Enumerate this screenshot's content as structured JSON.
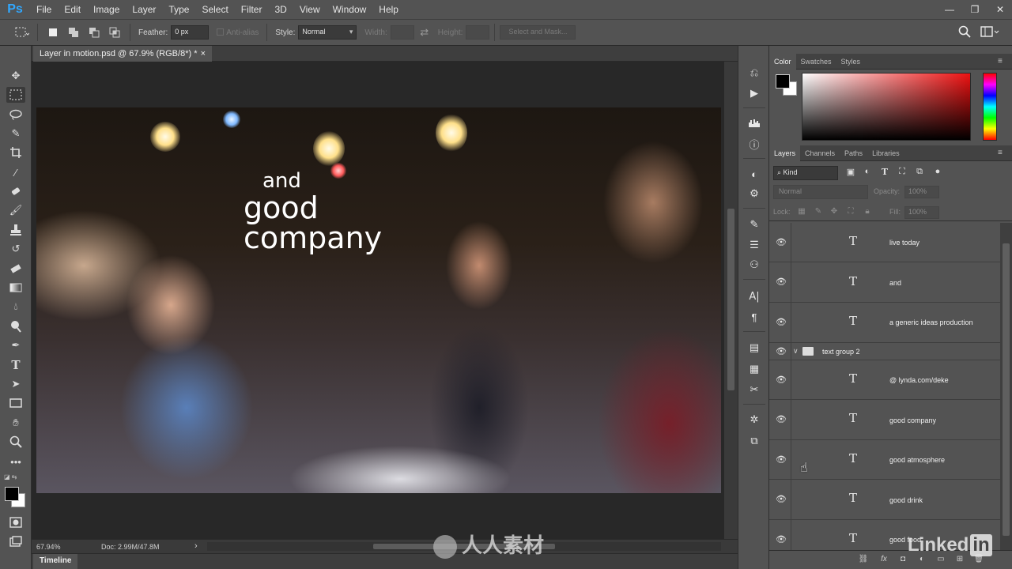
{
  "app": {
    "logo": "Ps",
    "menu": [
      "File",
      "Edit",
      "Image",
      "Layer",
      "Type",
      "Select",
      "Filter",
      "3D",
      "View",
      "Window",
      "Help"
    ],
    "window_controls": {
      "minimize": "—",
      "restore": "❐",
      "close": "✕"
    }
  },
  "options": {
    "feather_label": "Feather:",
    "feather_value": "0 px",
    "antialias_label": "Anti-alias",
    "style_label": "Style:",
    "style_value": "Normal",
    "width_label": "Width:",
    "height_label": "Height:",
    "select_mask_label": "Select and Mask..."
  },
  "document": {
    "tab_title": "Layer in motion.psd @ 67.9% (RGB/8*) *",
    "tab_close": "×",
    "overlay": {
      "line1": "and",
      "line2": "good",
      "line3": "company"
    },
    "zoom": "67.94%",
    "doc_size": "Doc: 2.99M/47.8M",
    "status_arrow": "›",
    "timeline_label": "Timeline"
  },
  "panels": {
    "color_tabs": [
      "Color",
      "Swatches",
      "Styles"
    ],
    "layers_tabs": [
      "Layers",
      "Channels",
      "Paths",
      "Libraries"
    ],
    "kind_value": "Kind",
    "blend_mode": "Normal",
    "opacity_label": "Opacity:",
    "opacity_value": "100%",
    "lock_label": "Lock:",
    "fill_label": "Fill:",
    "fill_value": "100%"
  },
  "layers": [
    {
      "kind": "text",
      "name": "live today"
    },
    {
      "kind": "text",
      "name": "and"
    },
    {
      "kind": "text",
      "name": "a generic ideas production"
    },
    {
      "kind": "group",
      "name": "text group 2"
    },
    {
      "kind": "text",
      "name": "@ lynda.com/deke"
    },
    {
      "kind": "text",
      "name": "good company"
    },
    {
      "kind": "text",
      "name": "good atmosphere"
    },
    {
      "kind": "text",
      "name": "good drink"
    },
    {
      "kind": "text",
      "name": "good food"
    }
  ],
  "watermarks": {
    "bottom_center": "人人素材",
    "linkedin": "Linked",
    "linkedin_in": "in"
  },
  "colors": {
    "ps_blue": "#31a8ff",
    "chrome": "#535353",
    "canvas_bg": "#282828",
    "foreground": "#000000",
    "background": "#ffffff"
  }
}
